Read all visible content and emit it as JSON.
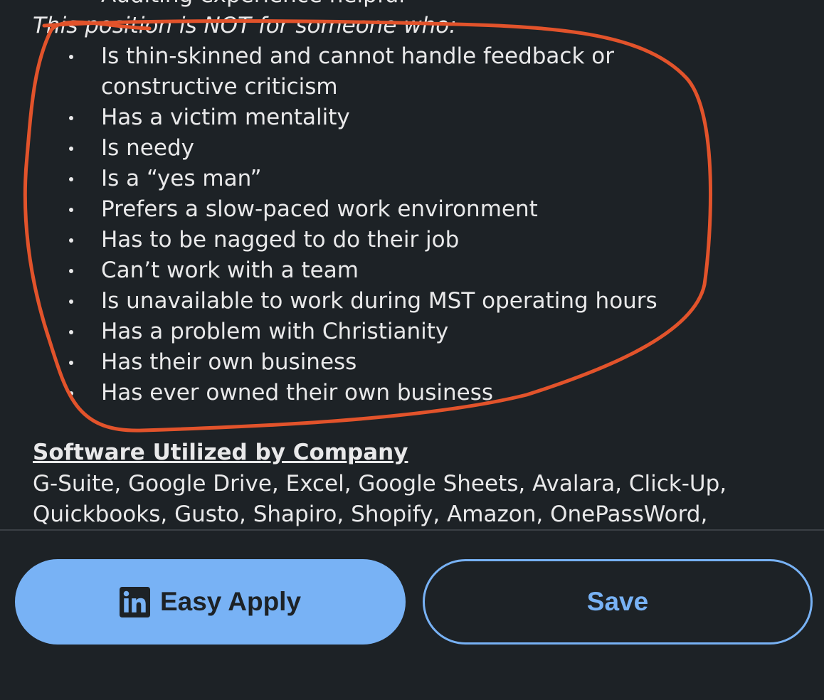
{
  "job_description": {
    "cut_line": "Auditing experience helpful",
    "not_for_intro": "This position is NOT for someone who:",
    "not_for_items": [
      "Is thin-skinned and cannot handle feedback or constructive criticism",
      "Has a victim mentality",
      "Is needy",
      "Is a “yes man”",
      "Prefers a slow-paced work environment",
      "Has to be nagged to do their job",
      "Can’t work with a team",
      "Is unavailable to work during MST operating hours",
      "Has a problem with Christianity",
      "Has their own business",
      "Has ever owned their own business"
    ],
    "software_title": "Software Utilized by Company",
    "software_list": "G-Suite, Google Drive, Excel, Google Sheets, Avalara, Click-Up, Quickbooks, Gusto, Shapiro, Shopify, Amazon, OnePassWord,"
  },
  "actions": {
    "apply_label": "Easy Apply",
    "apply_icon": "linkedin-icon",
    "save_label": "Save"
  },
  "colors": {
    "background": "#1d2226",
    "accent": "#78b2f5",
    "annotation": "#e2532b",
    "text": "#e9e9ea"
  }
}
